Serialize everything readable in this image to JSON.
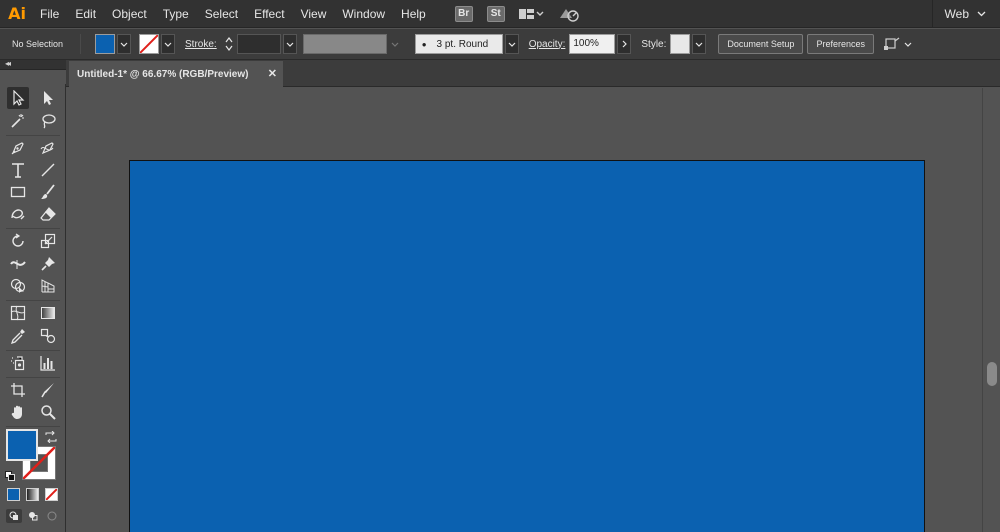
{
  "app": {
    "logo": "Ai",
    "menu": [
      "File",
      "Edit",
      "Object",
      "Type",
      "Select",
      "Effect",
      "View",
      "Window",
      "Help"
    ],
    "bridge_label": "Br",
    "stock_label": "St",
    "workspace": "Web"
  },
  "control_bar": {
    "selection_state": "No Selection",
    "fill_color": "#0b61b0",
    "stroke_label": "Stroke:",
    "brush_label": "3 pt. Round",
    "opacity_label": "Opacity:",
    "opacity_value": "100%",
    "style_label": "Style:",
    "document_setup": "Document Setup",
    "preferences": "Preferences"
  },
  "document": {
    "tab_title": "Untitled-1* @ 66.67% (RGB/Preview)",
    "close_glyph": "✕",
    "artboard_color": "#0b61b0"
  },
  "toolbar": {
    "collapse_glyph": "◂◂",
    "tools": [
      "selection-tool",
      "direct-selection-tool",
      "magic-wand-tool",
      "lasso-tool",
      "pen-tool",
      "curvature-tool",
      "type-tool",
      "line-segment-tool",
      "rectangle-tool",
      "paintbrush-tool",
      "shaper-tool",
      "eraser-tool",
      "rotate-tool",
      "scale-tool",
      "width-tool",
      "puppet-warp-tool",
      "shape-builder-tool",
      "perspective-grid-tool",
      "mesh-tool",
      "gradient-tool",
      "eyedropper-tool",
      "blend-tool",
      "symbol-sprayer-tool",
      "column-graph-tool",
      "artboard-tool",
      "slice-tool",
      "hand-tool",
      "zoom-tool"
    ],
    "fill_color": "#0b61b0",
    "stroke_color": "none"
  }
}
